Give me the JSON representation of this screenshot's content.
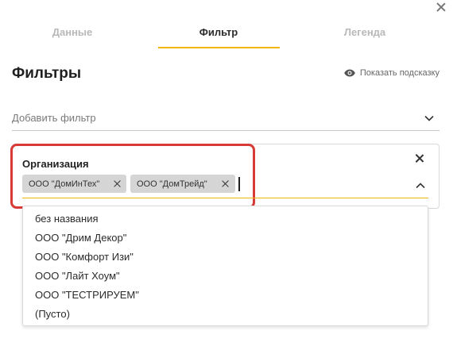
{
  "dialog": {
    "close_icon": "close-icon"
  },
  "tabs": [
    {
      "label": "Данные",
      "active": false
    },
    {
      "label": "Фильтр",
      "active": true
    },
    {
      "label": "Легенда",
      "active": false
    }
  ],
  "heading": "Фильтры",
  "hint": {
    "label": "Показать подсказку",
    "icon": "eye-icon"
  },
  "add_filter": {
    "label": "Добавить фильтр",
    "icon": "chevron-down-icon"
  },
  "filter": {
    "label": "Организация",
    "chips": [
      "ООО \"ДомИнТех\"",
      "ООО \"ДомТрейд\""
    ],
    "close_icon": "close-icon",
    "toggle_icon": "chevron-up-icon"
  },
  "dropdown": {
    "options": [
      "без названия",
      "ООО \"Дрим Декор\"",
      "ООО \"Комфорт Изи\"",
      "ООО \"Лайт Хоум\"",
      "ООО \"ТЕСТРИРУЕМ\"",
      "(Пусто)"
    ]
  },
  "colors": {
    "accent": "#f2b705",
    "highlight": "#d83a35",
    "chip": "#d5d5d5",
    "muted": "#b9b9b9"
  }
}
